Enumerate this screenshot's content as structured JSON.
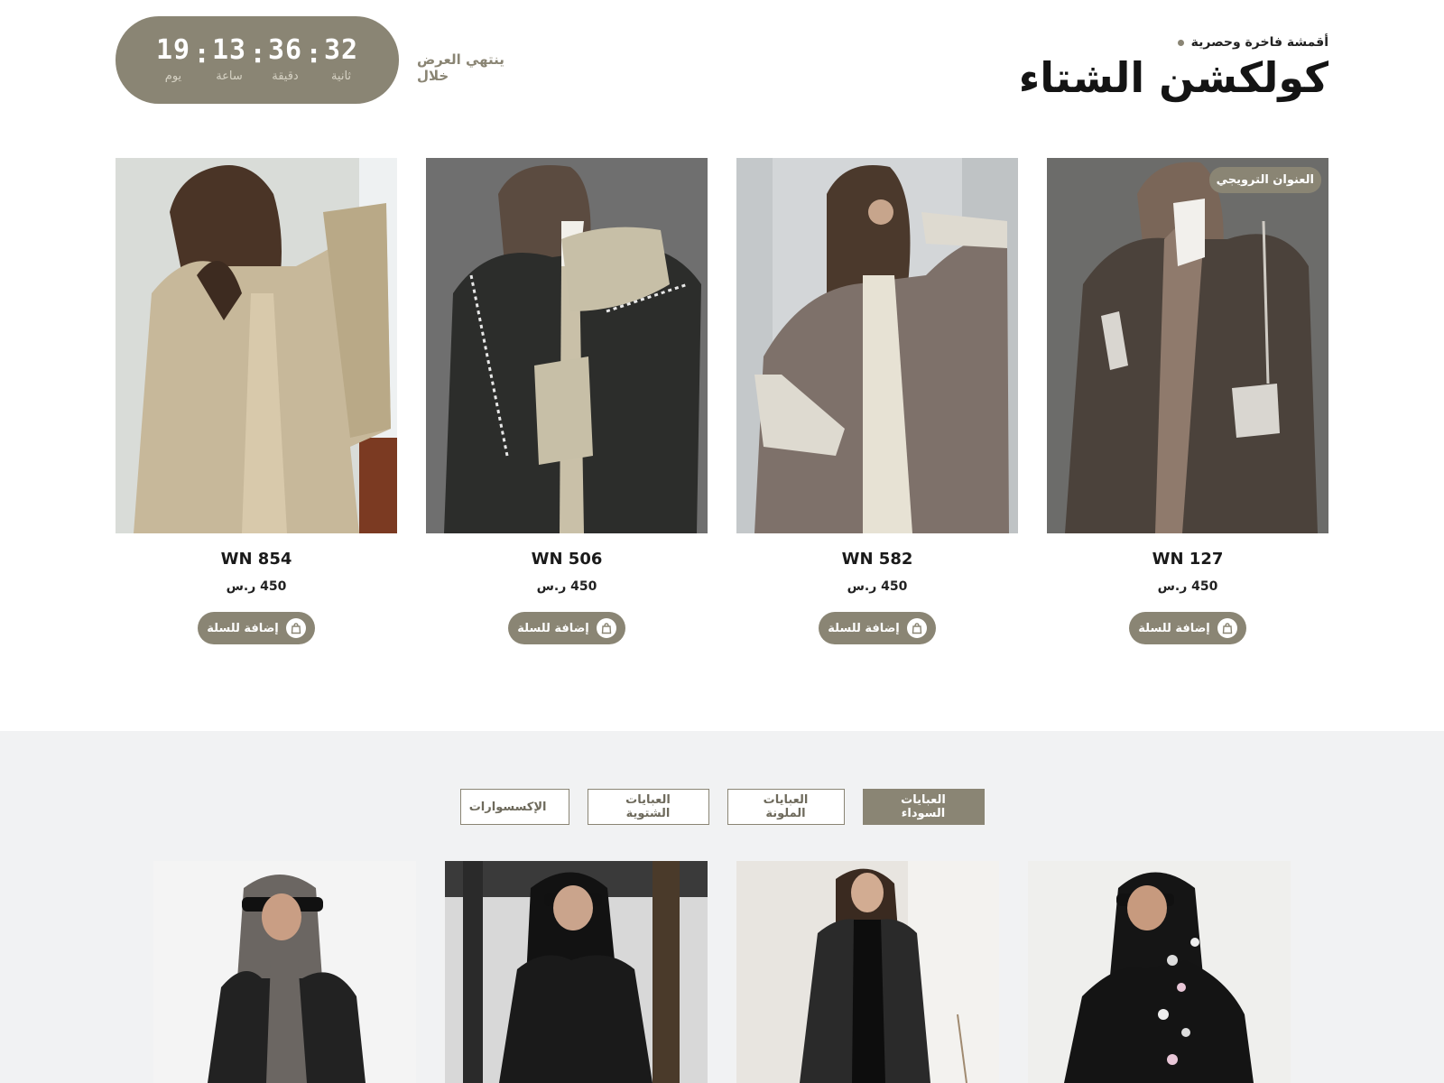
{
  "header": {
    "eyebrow": "أقمشة فاخرة وحصرية",
    "title": "كولكشن الشتاء"
  },
  "offer": {
    "label": "ينتهي العرض خلال",
    "countdown": [
      {
        "value": "19",
        "label": "يوم"
      },
      {
        "value": "13",
        "label": "ساعة"
      },
      {
        "value": "36",
        "label": "دقيقة"
      },
      {
        "value": "32",
        "label": "ثانية"
      }
    ]
  },
  "products": [
    {
      "name": "WN 854",
      "price": "450 ر.س",
      "button": "إضافة للسلة",
      "badge": ""
    },
    {
      "name": "WN 506",
      "price": "450 ر.س",
      "button": "إضافة للسلة",
      "badge": ""
    },
    {
      "name": "WN 582",
      "price": "450 ر.س",
      "button": "إضافة للسلة",
      "badge": ""
    },
    {
      "name": "WN 127",
      "price": "450 ر.س",
      "button": "إضافة للسلة",
      "badge": "العنوان الترويجي"
    }
  ],
  "tabs": [
    {
      "label": "العبايات السوداء",
      "active": true
    },
    {
      "label": "العبايات الملونة",
      "active": false
    },
    {
      "label": "العبايات الشتوية",
      "active": false
    },
    {
      "label": "الإكسسوارات",
      "active": false
    }
  ],
  "colors": {
    "accent": "#8a8574",
    "section_bg": "#f1f2f3"
  }
}
